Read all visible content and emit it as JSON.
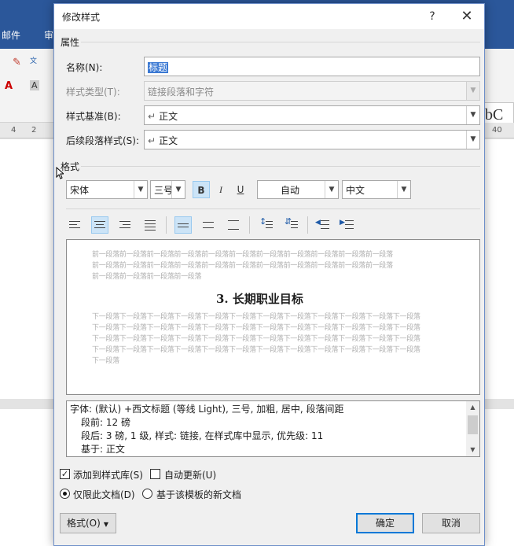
{
  "background_app": {
    "tabs": [
      "邮件",
      "审"
    ],
    "ruler_labels": [
      "4",
      "2",
      "40"
    ],
    "style_preview": "bC"
  },
  "dialog": {
    "title": "修改样式",
    "help_label": "?",
    "close_label": "✕",
    "properties_group": "属性",
    "name_label": "名称(N):",
    "name_value": "标题",
    "style_type_label": "样式类型(T):",
    "style_type_value": "链接段落和字符",
    "style_based_label": "样式基准(B):",
    "style_based_value": "正文",
    "next_style_label": "后续段落样式(S):",
    "next_style_value": "正文",
    "format_group": "格式",
    "font_name": "宋体",
    "font_size": "三号",
    "bold_label": "B",
    "italic_label": "I",
    "underline_label": "U",
    "font_color": "自动",
    "language": "中文",
    "preview": {
      "before_lines": [
        "前一段落前一段落前一段落前一段落前一段落前一段落前一段落前一段落前一段落前一段落前一段落",
        "前一段落前一段落前一段落前一段落前一段落前一段落前一段落前一段落前一段落前一段落前一段落",
        "前一段落前一段落前一段落前一段落"
      ],
      "heading": "3. 长期职业目标",
      "after_lines": [
        "下一段落下一段落下一段落下一段落下一段落下一段落下一段落下一段落下一段落下一段落下一段落下一段落",
        "下一段落下一段落下一段落下一段落下一段落下一段落下一段落下一段落下一段落下一段落下一段落下一段落",
        "下一段落下一段落下一段落下一段落下一段落下一段落下一段落下一段落下一段落下一段落下一段落下一段落",
        "下一段落下一段落下一段落下一段落下一段落下一段落下一段落下一段落下一段落下一段落下一段落下一段落",
        "下一段落"
      ]
    },
    "description_lines": [
      "字体: (默认) +西文标题 (等线 Light), 三号, 加粗, 居中, 段落间距",
      "    段前: 12 磅",
      "    段后: 3 磅, 1 级, 样式: 链接, 在样式库中显示, 优先级: 11",
      "    基于: 正文"
    ],
    "add_to_gallery_label": "添加到样式库(S)",
    "add_to_gallery_checked": true,
    "auto_update_label": "自动更新(U)",
    "auto_update_checked": false,
    "only_this_doc_label": "仅限此文档(D)",
    "new_docs_template_label": "基于该模板的新文档",
    "format_button": "格式(O)",
    "ok_button": "确定",
    "cancel_button": "取消",
    "colors": {
      "accent": "#0078d7",
      "selection": "#3b79d3",
      "ribbon": "#2b579a"
    }
  }
}
